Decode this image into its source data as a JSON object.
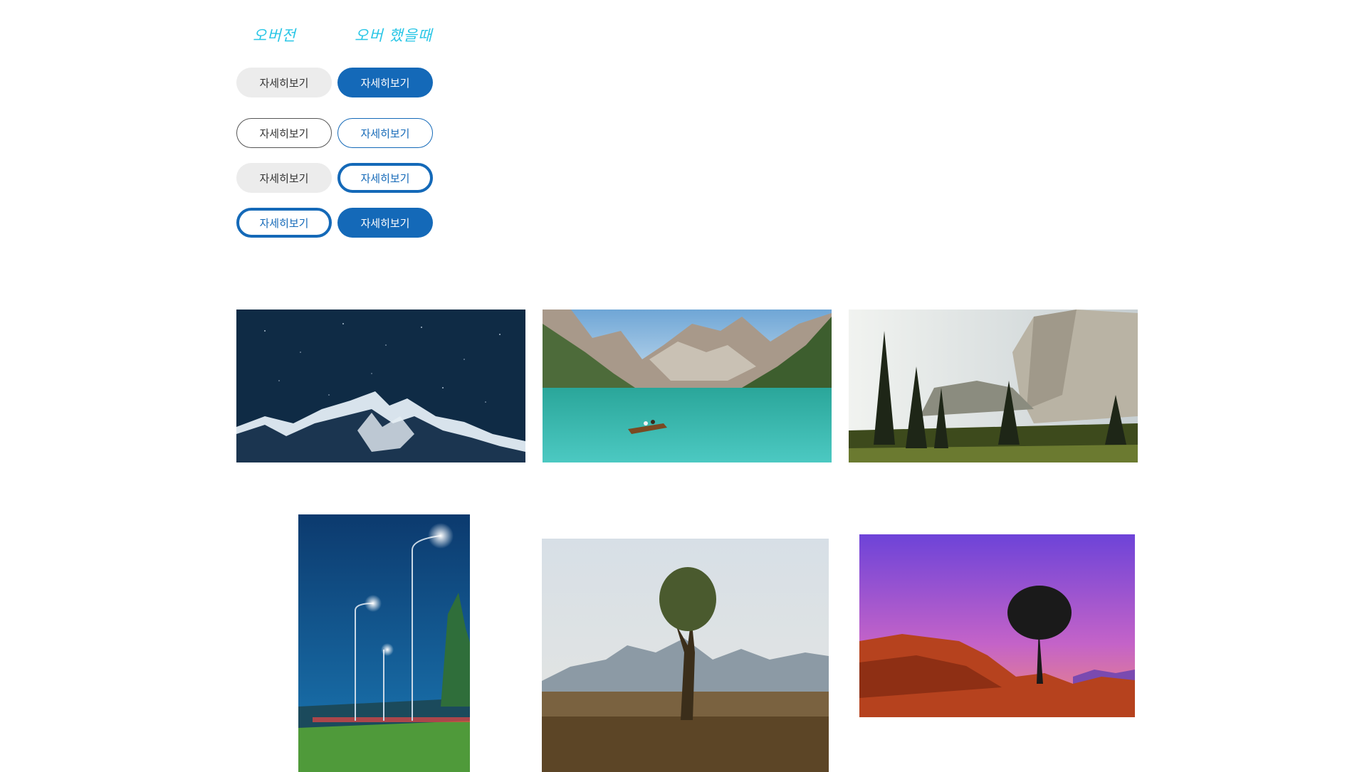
{
  "headers": {
    "before": "오버전",
    "after": "오버 했을때"
  },
  "buttons": {
    "label": "자세히보기"
  },
  "photos": [
    {
      "icon": "starry-mountain-night-image"
    },
    {
      "icon": "alpine-lake-boat-image"
    },
    {
      "icon": "cliff-forest-image"
    },
    {
      "icon": "streetlights-night-image"
    },
    {
      "icon": "lone-tree-mountains-image"
    },
    {
      "icon": "desert-sunset-tree-image"
    }
  ],
  "colors": {
    "accent_blue": "#1469b8",
    "hover_label_cyan": "#29c6e6",
    "button_gray": "#ececec"
  }
}
